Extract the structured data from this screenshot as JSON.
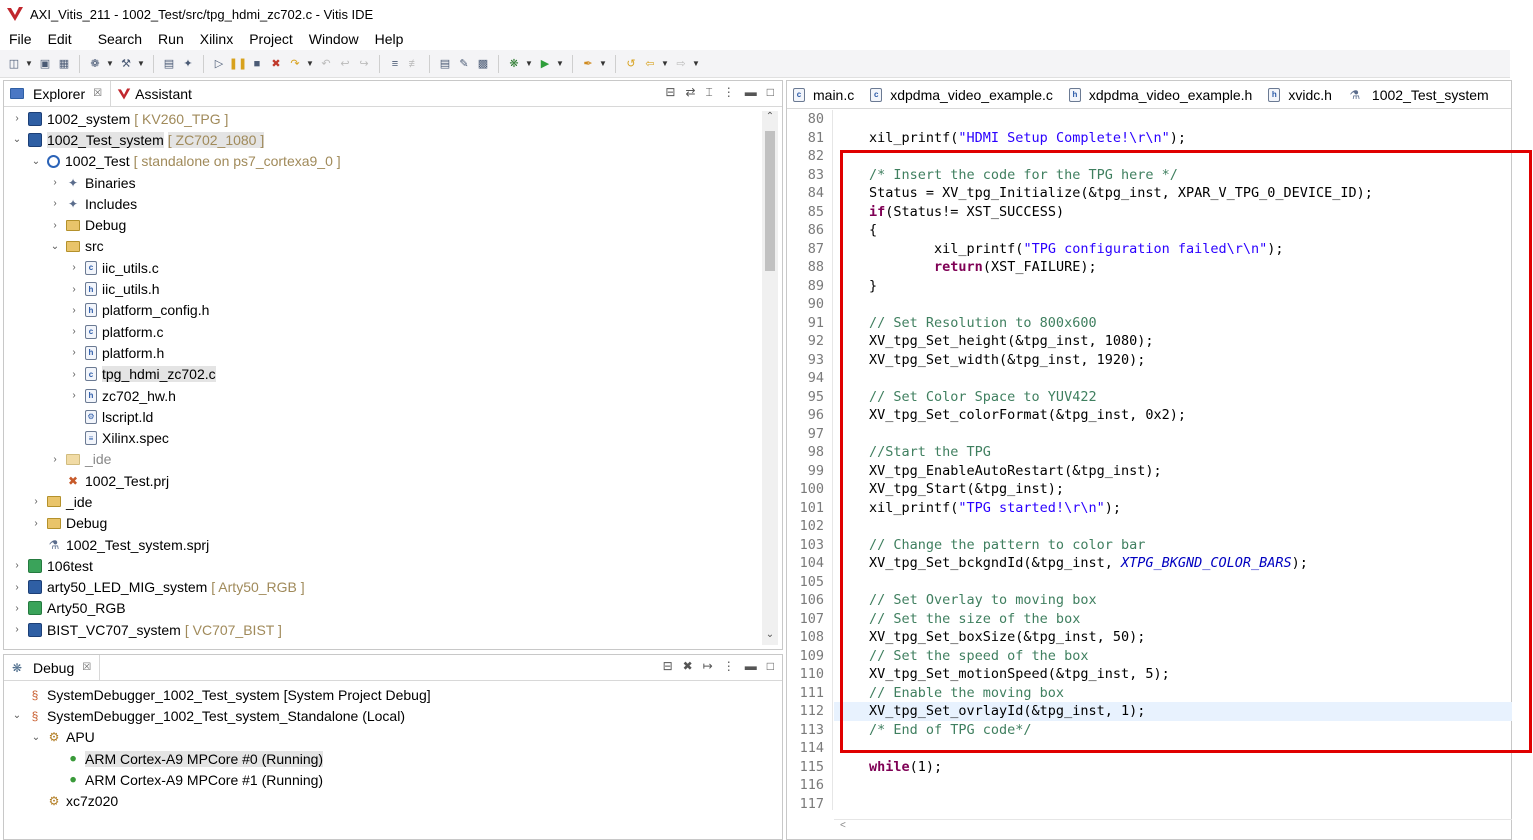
{
  "window": {
    "title": "AXI_Vitis_211 - 1002_Test/src/tpg_hdmi_zc702.c - Vitis IDE"
  },
  "menu": [
    "File",
    "Edit",
    "Search",
    "Run",
    "Xilinx",
    "Project",
    "Window",
    "Help"
  ],
  "explorer": {
    "tabs": [
      {
        "label": "Explorer",
        "close": "☒"
      },
      {
        "label": "Assistant"
      }
    ],
    "tree": [
      {
        "indent": 0,
        "twisty": ">",
        "icon": "sys",
        "label": "1002_system",
        "sub": "[ KV260_TPG ]"
      },
      {
        "indent": 0,
        "twisty": "v",
        "icon": "sys",
        "label": "1002_Test_system",
        "sub": "[ ZC702_1080 ]",
        "selected": true
      },
      {
        "indent": 1,
        "twisty": "v",
        "icon": "app",
        "label": "1002_Test",
        "sub": "[ standalone on ps7_cortexa9_0 ]"
      },
      {
        "indent": 2,
        "twisty": ">",
        "icon": "bin",
        "label": "Binaries",
        "sub": ""
      },
      {
        "indent": 2,
        "twisty": ">",
        "icon": "bin",
        "label": "Includes",
        "sub": ""
      },
      {
        "indent": 2,
        "twisty": ">",
        "icon": "folder",
        "label": "Debug",
        "sub": ""
      },
      {
        "indent": 2,
        "twisty": "v",
        "icon": "folder",
        "label": "src",
        "sub": ""
      },
      {
        "indent": 3,
        "twisty": ">",
        "icon": "c",
        "label": "iic_utils.c",
        "sub": ""
      },
      {
        "indent": 3,
        "twisty": ">",
        "icon": "h",
        "label": "iic_utils.h",
        "sub": ""
      },
      {
        "indent": 3,
        "twisty": ">",
        "icon": "h",
        "label": "platform_config.h",
        "sub": ""
      },
      {
        "indent": 3,
        "twisty": ">",
        "icon": "c",
        "label": "platform.c",
        "sub": ""
      },
      {
        "indent": 3,
        "twisty": ">",
        "icon": "h",
        "label": "platform.h",
        "sub": ""
      },
      {
        "indent": 3,
        "twisty": ">",
        "icon": "c",
        "label": "tpg_hdmi_zc702.c",
        "sub": "",
        "selected": true
      },
      {
        "indent": 3,
        "twisty": ">",
        "icon": "h",
        "label": "zc702_hw.h",
        "sub": ""
      },
      {
        "indent": 3,
        "twisty": "",
        "icon": "ld",
        "label": "lscript.ld",
        "sub": ""
      },
      {
        "indent": 3,
        "twisty": "",
        "icon": "spec",
        "label": "Xilinx.spec",
        "sub": ""
      },
      {
        "indent": 2,
        "twisty": ">",
        "icon": "folder-x",
        "label": "_ide",
        "sub": "",
        "dim": true
      },
      {
        "indent": 2,
        "twisty": "",
        "icon": "prj",
        "label": "1002_Test.prj",
        "sub": ""
      },
      {
        "indent": 1,
        "twisty": ">",
        "icon": "folder",
        "label": "_ide",
        "sub": ""
      },
      {
        "indent": 1,
        "twisty": ">",
        "icon": "folder",
        "label": "Debug",
        "sub": ""
      },
      {
        "indent": 1,
        "twisty": "",
        "icon": "sprj",
        "label": "1002_Test_system.sprj",
        "sub": ""
      },
      {
        "indent": 0,
        "twisty": ">",
        "icon": "sys-green",
        "label": "106test",
        "sub": ""
      },
      {
        "indent": 0,
        "twisty": ">",
        "icon": "sys",
        "label": "arty50_LED_MIG_system",
        "sub": "[ Arty50_RGB ]"
      },
      {
        "indent": 0,
        "twisty": ">",
        "icon": "sys-green",
        "label": "Arty50_RGB",
        "sub": ""
      },
      {
        "indent": 0,
        "twisty": ">",
        "icon": "sys",
        "label": "BIST_VC707_system",
        "sub": "[ VC707_BIST ]"
      }
    ]
  },
  "debug": {
    "tab_label": "Debug",
    "close": "☒",
    "tree": [
      {
        "indent": 0,
        "twisty": "",
        "icon": "dbg",
        "label": "SystemDebugger_1002_Test_system [System Project Debug]"
      },
      {
        "indent": 0,
        "twisty": "v",
        "icon": "dbg",
        "label": "SystemDebugger_1002_Test_system_Standalone (Local)"
      },
      {
        "indent": 1,
        "twisty": "v",
        "icon": "apu",
        "label": "APU"
      },
      {
        "indent": 2,
        "twisty": "",
        "icon": "core",
        "label": "ARM Cortex-A9 MPCore #0 (Running)",
        "selected": true
      },
      {
        "indent": 2,
        "twisty": "",
        "icon": "core",
        "label": "ARM Cortex-A9 MPCore #1 (Running)"
      },
      {
        "indent": 1,
        "twisty": "",
        "icon": "apu",
        "label": "xc7z020"
      }
    ]
  },
  "editor": {
    "tabs": [
      {
        "label": "main.c"
      },
      {
        "label": "xdpdma_video_example.c"
      },
      {
        "label": "xdpdma_video_example.h"
      },
      {
        "label": "xvidc.h"
      },
      {
        "label": "1002_Test_system"
      }
    ],
    "first_line": 80,
    "current_line": 112,
    "lines": [
      "",
      "xil_printf(\"HDMI Setup Complete!\\r\\n\");",
      "",
      "/* Insert the code for the TPG here */",
      "Status = XV_tpg_Initialize(&tpg_inst, XPAR_V_TPG_0_DEVICE_ID);",
      "if(Status!= XST_SUCCESS)",
      "{",
      "        xil_printf(\"TPG configuration failed\\r\\n\");",
      "        return(XST_FAILURE);",
      "}",
      "",
      "// Set Resolution to 800x600",
      "XV_tpg_Set_height(&tpg_inst, 1080);",
      "XV_tpg_Set_width(&tpg_inst, 1920);",
      "",
      "// Set Color Space to YUV422",
      "XV_tpg_Set_colorFormat(&tpg_inst, 0x2);",
      "",
      "//Start the TPG",
      "XV_tpg_EnableAutoRestart(&tpg_inst);",
      "XV_tpg_Start(&tpg_inst);",
      "xil_printf(\"TPG started!\\r\\n\");",
      "",
      "// Change the pattern to color bar",
      "XV_tpg_Set_bckgndId(&tpg_inst, XTPG_BKGND_COLOR_BARS);",
      "",
      "// Set Overlay to moving box",
      "// Set the size of the box",
      "XV_tpg_Set_boxSize(&tpg_inst, 50);",
      "// Set the speed of the box",
      "XV_tpg_Set_motionSpeed(&tpg_inst, 5);",
      "// Enable the moving box",
      "XV_tpg_Set_ovrlayId(&tpg_inst, 1);",
      "/* End of TPG code*/",
      "",
      "while(1);",
      "",
      ""
    ]
  },
  "colors": {
    "keyword": "#7f0055",
    "string": "#2a00ff",
    "comment": "#3f7f5f",
    "macro": "#0000c0",
    "highlight_box": "#e00000"
  }
}
